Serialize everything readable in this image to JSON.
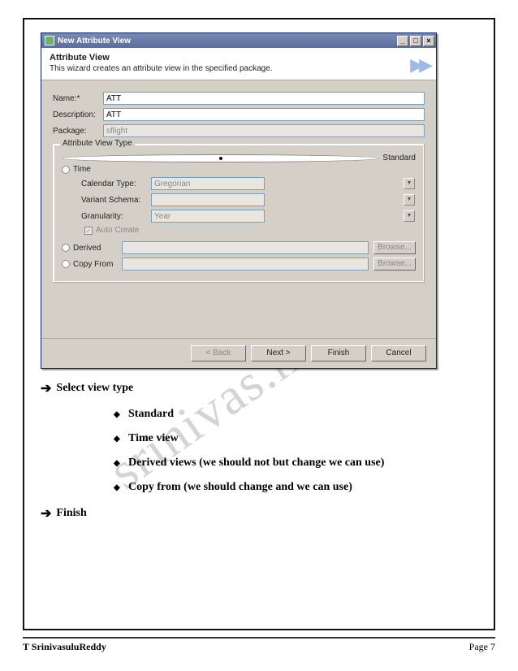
{
  "dialog": {
    "window_title": "New Attribute View",
    "header_title": "Attribute View",
    "header_sub": "This wizard creates an attribute view in the specified package.",
    "name_label": "Name:*",
    "name_value": "ATT",
    "desc_label": "Description:",
    "desc_value": "ATT",
    "pkg_label": "Package:",
    "pkg_value": "sflight",
    "group_legend": "Attribute View Type",
    "radio_standard": "Standard",
    "radio_time": "Time",
    "cal_label": "Calendar Type:",
    "cal_value": "Gregorian",
    "var_label": "Variant Schema:",
    "var_value": "",
    "gran_label": "Granularity:",
    "gran_value": "Year",
    "auto_create": "Auto Create",
    "radio_derived": "Derived",
    "radio_copy": "Copy From",
    "browse": "Browse...",
    "back": "< Back",
    "next": "Next >",
    "finish": "Finish",
    "cancel": "Cancel"
  },
  "notes": {
    "line1": "Select view type",
    "b1": "Standard",
    "b2": "Time view",
    "b3": "Derived views (we should not but change we can use)",
    "b4": "Copy from (we should change and we can use)",
    "line2": "Finish"
  },
  "watermark": "srinivas.hana              m",
  "footer": {
    "author": "T SrinivasuluReddy",
    "page": "Page 7"
  }
}
